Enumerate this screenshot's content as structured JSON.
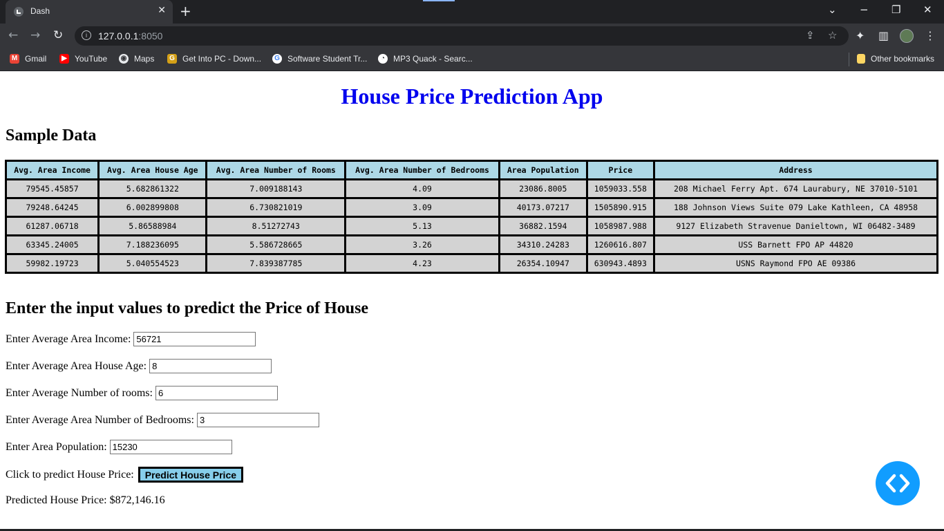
{
  "browser": {
    "tab_title": "Dash",
    "url_host": "127.0.0.1",
    "url_port": ":8050",
    "bookmarks": [
      {
        "label": "Gmail",
        "icon": "gmail-icon",
        "color": "#ea4335"
      },
      {
        "label": "YouTube",
        "icon": "youtube-icon",
        "color": "#ff0000"
      },
      {
        "label": "Maps",
        "icon": "maps-icon",
        "color": "#e8eaed"
      },
      {
        "label": "Get Into PC - Down...",
        "icon": "getintopc-icon",
        "color": "#d4a017"
      },
      {
        "label": "Software Student Tr...",
        "icon": "google-icon",
        "color": "#ffffff"
      },
      {
        "label": "MP3 Quack - Searc...",
        "icon": "mp3quack-icon",
        "color": "#ffffff"
      }
    ],
    "other_bookmarks": "Other bookmarks"
  },
  "app": {
    "title": "House Price Prediction App",
    "sample_heading": "Sample Data",
    "input_heading": "Enter the input values to predict the Price of House"
  },
  "table": {
    "headers": [
      "Avg. Area Income",
      "Avg. Area House Age",
      "Avg. Area Number of Rooms",
      "Avg. Area Number of Bedrooms",
      "Area Population",
      "Price",
      "Address"
    ],
    "rows": [
      [
        "79545.45857",
        "5.682861322",
        "7.009188143",
        "4.09",
        "23086.8005",
        "1059033.558",
        "208 Michael Ferry Apt. 674 Laurabury, NE 37010-5101"
      ],
      [
        "79248.64245",
        "6.002899808",
        "6.730821019",
        "3.09",
        "40173.07217",
        "1505890.915",
        "188 Johnson Views Suite 079 Lake Kathleen, CA 48958"
      ],
      [
        "61287.06718",
        "5.86588984",
        "8.51272743",
        "5.13",
        "36882.1594",
        "1058987.988",
        "9127 Elizabeth Stravenue Danieltown, WI 06482-3489"
      ],
      [
        "63345.24005",
        "7.188236095",
        "5.586728665",
        "3.26",
        "34310.24283",
        "1260616.807",
        "USS Barnett FPO AP 44820"
      ],
      [
        "59982.19723",
        "5.040554523",
        "7.839387785",
        "4.23",
        "26354.10947",
        "630943.4893",
        "USNS Raymond FPO AE 09386"
      ]
    ]
  },
  "form": {
    "income": {
      "label": "Enter Average Area Income:",
      "value": "56721"
    },
    "age": {
      "label": "Enter Average Area House Age:",
      "value": "8"
    },
    "rooms": {
      "label": "Enter Average Number of rooms:",
      "value": "6"
    },
    "bedrooms": {
      "label": "Enter Average Area Number of Bedrooms:",
      "value": "3"
    },
    "population": {
      "label": "Enter Area Population:",
      "value": "15230"
    },
    "predict_label": "Click to predict House Price:",
    "predict_button": "Predict House Price",
    "result": "Predicted House Price: $872,146.16"
  },
  "colors": {
    "title": "#0000ee",
    "header_bg": "#add8e6",
    "cell_bg": "#d3d3d3",
    "button_bg": "#87ceeb",
    "fab": "#119dff"
  }
}
